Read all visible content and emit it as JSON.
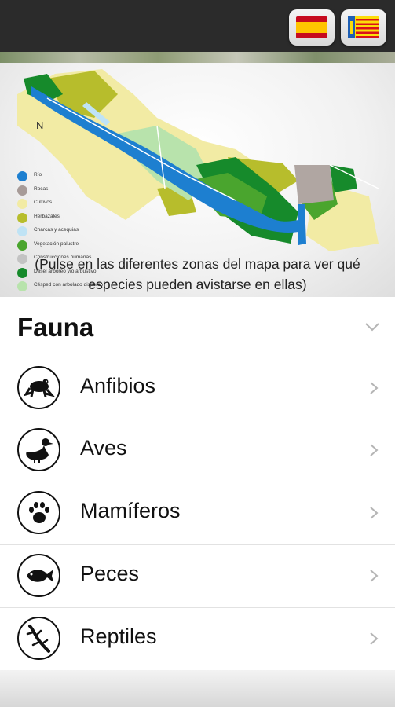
{
  "top_bar": {
    "buttons": [
      {
        "flag": "flag-spain-icon"
      },
      {
        "flag": "flag-valencia-icon"
      }
    ]
  },
  "map": {
    "north_label": "N",
    "legend": [
      {
        "label": "Río",
        "color": "#1d7fd0"
      },
      {
        "label": "Rocas",
        "color": "#a79b98"
      },
      {
        "label": "Cultivos",
        "color": "#f2eba4"
      },
      {
        "label": "Herbazales",
        "color": "#b7bd2c"
      },
      {
        "label": "Charcas y acequias",
        "color": "#bfe3f5"
      },
      {
        "label": "Vegetación palustre",
        "color": "#4aa52e"
      },
      {
        "label": "Construcciones humanas",
        "color": "#c3c3c3"
      },
      {
        "label": "Dosel arbóreo y/o arbustivo",
        "color": "#168a2b"
      },
      {
        "label": "Césped con arbolado disperso",
        "color": "#b8e3ac"
      }
    ],
    "caption_line1": "(Pulse en las diferentes zonas del mapa para ver qué",
    "caption_line2": "especies pueden avistarse en ellas)"
  },
  "fauna": {
    "title": "Fauna",
    "items": [
      {
        "label": "Anfibios",
        "icon": "frog-icon"
      },
      {
        "label": "Aves",
        "icon": "duck-icon"
      },
      {
        "label": "Mamíferos",
        "icon": "paw-print-icon"
      },
      {
        "label": "Peces",
        "icon": "fish-icon"
      },
      {
        "label": "Reptiles",
        "icon": "lizard-icon"
      }
    ]
  },
  "colors": {
    "top_bar": "#2b2b2b",
    "text": "#111111",
    "chevron": "#b5b5b5"
  }
}
